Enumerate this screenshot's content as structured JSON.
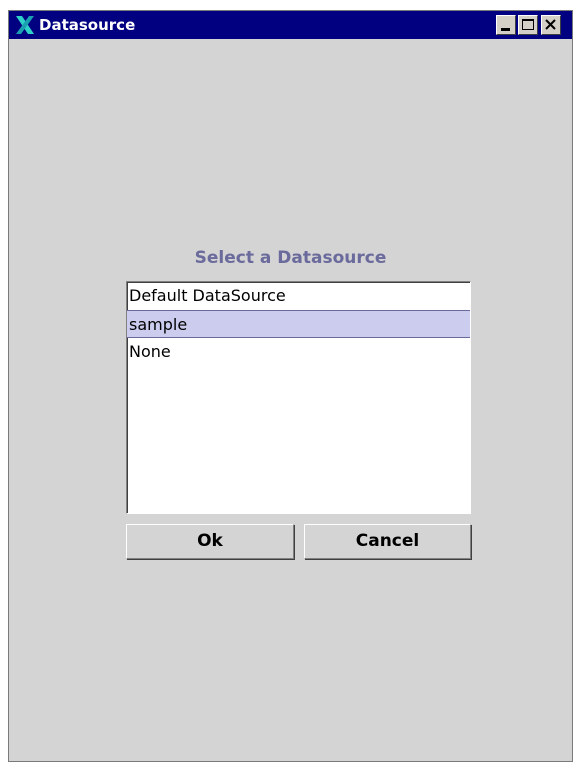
{
  "window": {
    "title": "Datasource"
  },
  "dialog": {
    "heading": "Select a Datasource",
    "list_items": [
      "Default DataSource",
      "sample",
      "None"
    ],
    "selected_item": "sample",
    "ok_label": "Ok",
    "cancel_label": "Cancel"
  },
  "colors": {
    "titlebar": "#000080",
    "window_bg": "#d4d4d4",
    "heading": "#6b6a9c",
    "selection": "#ccccee"
  },
  "icons": {
    "app": "x-logo-icon",
    "minimize": "minimize-icon",
    "maximize": "maximize-icon",
    "close": "close-icon"
  }
}
